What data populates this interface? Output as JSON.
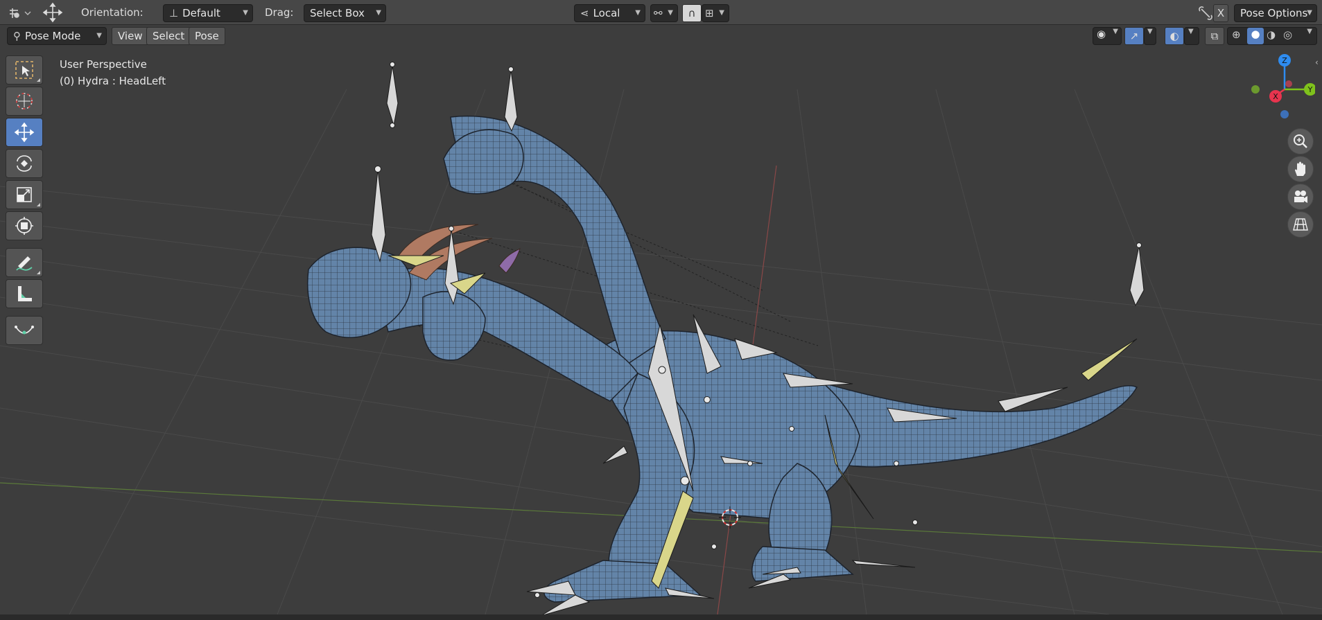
{
  "header": {
    "editor_icon": "editor-type-icon",
    "transform_icon": "move-cross-icon",
    "orientation_label": "Orientation:",
    "orientation_value": "Default",
    "drag_label": "Drag:",
    "drag_value": "Select Box",
    "pivot_value": "Local",
    "close_x": "X",
    "pose_options": "Pose Options"
  },
  "subheader": {
    "mode": "Pose Mode",
    "menus": [
      "View",
      "Select",
      "Pose"
    ]
  },
  "viewport": {
    "view_name": "User Perspective",
    "object_info": "(0) Hydra : HeadLeft"
  },
  "gizmo": {
    "z": "Z",
    "y": "Y",
    "x": "X",
    "colors": {
      "x": "#e8344e",
      "y": "#7fc21c",
      "z": "#2e8cf0"
    }
  },
  "toolbar": {
    "tools": [
      "select-box-tool",
      "cursor-tool",
      "move-tool",
      "rotate-tool",
      "scale-tool",
      "transform-tool",
      "annotate-tool",
      "measure-tool",
      "curve-tool"
    ],
    "active": "move-tool"
  },
  "colors": {
    "active_blue": "#5680c2",
    "mesh_blue": "#5b7a9e",
    "bone": "#d8d8d8",
    "bone_selected": "#d9d68a",
    "horn": "#b07a62"
  }
}
